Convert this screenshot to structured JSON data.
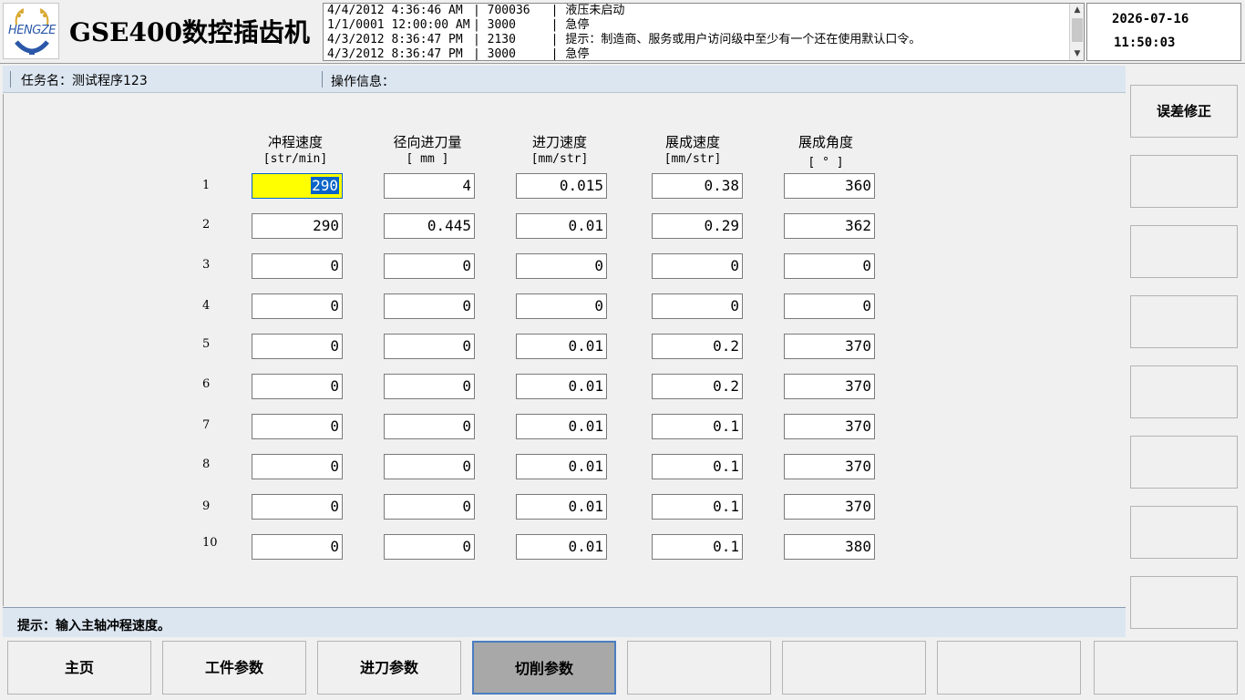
{
  "header": {
    "logo_text": "HENGZE",
    "app_title": "GSE400数控插齿机",
    "log": [
      {
        "time": "4/4/2012 4:36:46 AM",
        "code": "700036",
        "msg": "液压未启动"
      },
      {
        "time": "1/1/0001 12:00:00 AM",
        "code": "3000",
        "msg": "急停"
      },
      {
        "time": "4/3/2012 8:36:47 PM",
        "code": "2130",
        "msg": "提示：制造商、服务或用户访问级中至少有一个还在使用默认口令。"
      },
      {
        "time": "4/3/2012 8:36:47 PM",
        "code": "3000",
        "msg": "急停"
      }
    ],
    "date": "2026-07-16",
    "time": "11:50:03"
  },
  "info_bar": {
    "task_label": "任务名：测试程序123",
    "op_label": "操作信息："
  },
  "table": {
    "columns": [
      {
        "label": "冲程速度",
        "unit": "[str/min]"
      },
      {
        "label": "径向进刀量",
        "unit": "[ mm ]"
      },
      {
        "label": "进刀速度",
        "unit": "[mm/str]"
      },
      {
        "label": "展成速度",
        "unit": "[mm/str]"
      },
      {
        "label": "展成角度",
        "unit": "[ ° ]"
      }
    ],
    "rows": [
      {
        "num": "1",
        "values": [
          "290",
          "4",
          "0.015",
          "0.38",
          "360"
        ]
      },
      {
        "num": "2",
        "values": [
          "290",
          "0.445",
          "0.01",
          "0.29",
          "362"
        ]
      },
      {
        "num": "3",
        "values": [
          "0",
          "0",
          "0",
          "0",
          "0"
        ]
      },
      {
        "num": "4",
        "values": [
          "0",
          "0",
          "0",
          "0",
          "0"
        ]
      },
      {
        "num": "5",
        "values": [
          "0",
          "0",
          "0.01",
          "0.2",
          "370"
        ]
      },
      {
        "num": "6",
        "values": [
          "0",
          "0",
          "0.01",
          "0.2",
          "370"
        ]
      },
      {
        "num": "7",
        "values": [
          "0",
          "0",
          "0.01",
          "0.1",
          "370"
        ]
      },
      {
        "num": "8",
        "values": [
          "0",
          "0",
          "0.01",
          "0.1",
          "370"
        ]
      },
      {
        "num": "9",
        "values": [
          "0",
          "0",
          "0.01",
          "0.1",
          "370"
        ]
      },
      {
        "num": "10",
        "values": [
          "0",
          "0",
          "0.01",
          "0.1",
          "380"
        ]
      }
    ]
  },
  "hint": "提示：输入主轴冲程速度。",
  "side_buttons": [
    "误差修正",
    "",
    "",
    "",
    "",
    "",
    "",
    ""
  ],
  "bottom_buttons": [
    "主页",
    "工件参数",
    "进刀参数",
    "切削参数",
    "",
    "",
    "",
    ""
  ],
  "colors": {
    "active_cell": "#ffff00",
    "selection": "#0a64c8",
    "info_bar": "#dce6f1",
    "selected_tab": "#a8a8a8"
  }
}
